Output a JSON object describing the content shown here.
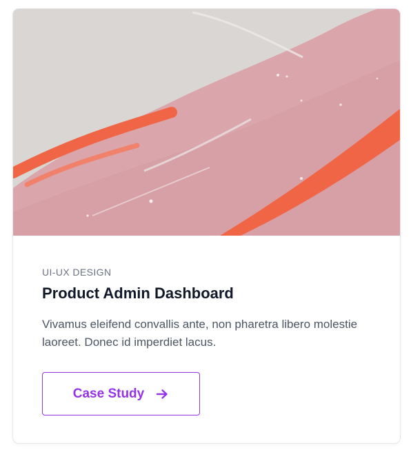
{
  "card": {
    "image_alt": "",
    "category": "UI-UX DESIGN",
    "title": "Product Admin Dashboard",
    "description": "Vivamus eleifend convallis ante, non pharetra libero molestie laoreet. Donec id imperdiet lacus.",
    "cta_label": "Case Study",
    "cta_icon": "arrow-right-icon"
  },
  "colors": {
    "accent": "#9333ea",
    "title": "#111827",
    "category": "#6b7280",
    "body_text": "#4b5563",
    "border": "#e5e7eb",
    "image_pink": "#d9a3aa",
    "image_orange": "#f06546",
    "image_gray": "#d9d6d3"
  }
}
